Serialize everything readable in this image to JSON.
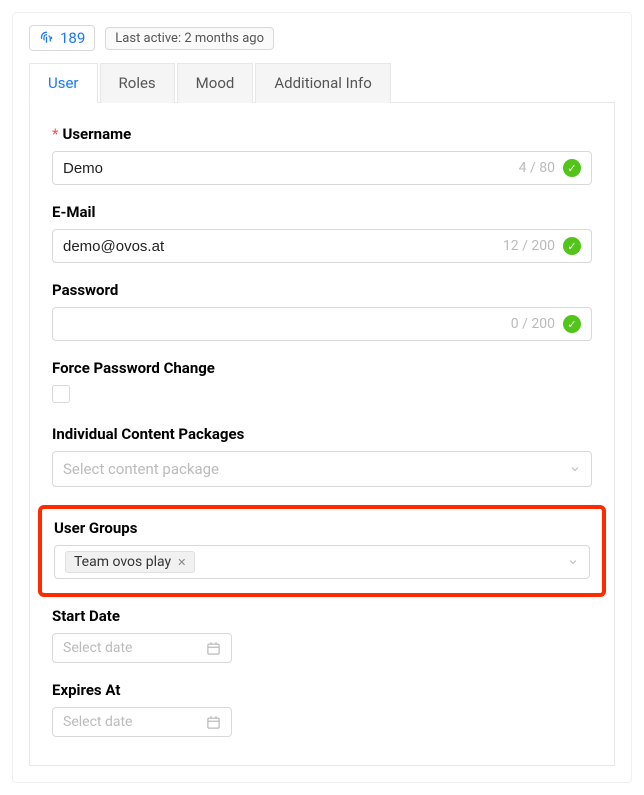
{
  "header": {
    "id": "189",
    "lastActive": "Last active: 2 months ago"
  },
  "tabs": {
    "user": "User",
    "roles": "Roles",
    "mood": "Mood",
    "additional": "Additional Info"
  },
  "fields": {
    "username": {
      "label": "Username",
      "value": "Demo",
      "counter": "4 / 80"
    },
    "email": {
      "label": "E-Mail",
      "value": "demo@ovos.at",
      "counter": "12 / 200"
    },
    "password": {
      "label": "Password",
      "value": "",
      "counter": "0 / 200"
    },
    "forcePassword": {
      "label": "Force Password Change"
    },
    "contentPackages": {
      "label": "Individual Content Packages",
      "placeholder": "Select content package"
    },
    "userGroups": {
      "label": "User Groups",
      "tag": "Team ovos play"
    },
    "startDate": {
      "label": "Start Date",
      "placeholder": "Select date"
    },
    "expiresAt": {
      "label": "Expires At",
      "placeholder": "Select date"
    }
  }
}
